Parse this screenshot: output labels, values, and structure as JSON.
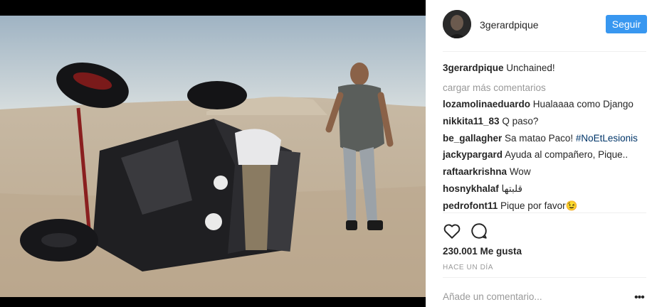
{
  "post": {
    "username": "3gerardpique",
    "follow_label": "Seguir",
    "caption_text": "Unchained!",
    "load_more": "cargar más comentarios",
    "comments": [
      {
        "user": "lozamolinaeduardo",
        "text": "Hualaaaa como Django"
      },
      {
        "user": "nikkita11_83",
        "text": "Q paso?"
      },
      {
        "user": "be_gallagher",
        "text": "Sa matao Paco!",
        "tag": "#NoEtLesionis"
      },
      {
        "user": "jackypargard",
        "text": "Ayuda al compañero, Pique.."
      },
      {
        "user": "raftaarkrishna",
        "text": "Wow"
      },
      {
        "user": "hosnykhalaf",
        "text": "قلبتها"
      },
      {
        "user": "pedrofont11",
        "text": "Pique por favor😉"
      }
    ],
    "likes": "230.001 Me gusta",
    "time": "HACE UN DÍA",
    "add_comment_placeholder": "Añade un comentario...",
    "more_glyph": "•••"
  },
  "icons": {
    "heart": "heart-icon",
    "comment": "comment-bubble-icon",
    "more": "more-options-icon"
  },
  "colors": {
    "accent": "#3897f0",
    "hashtag": "#003569",
    "muted": "#999999",
    "text": "#262626"
  }
}
